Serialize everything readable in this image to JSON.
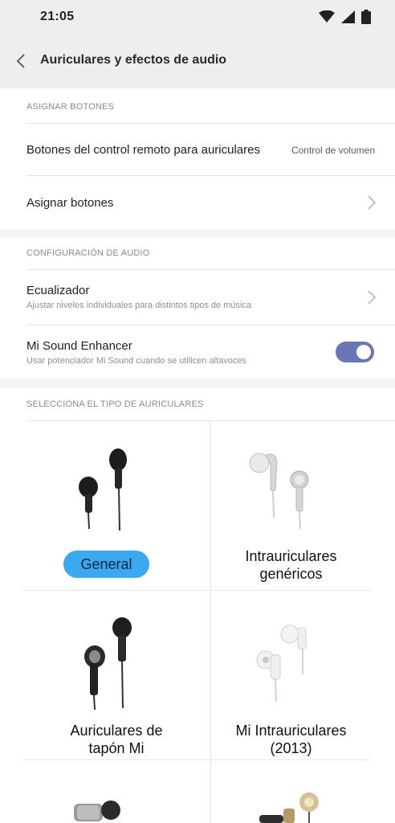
{
  "status_bar": {
    "time": "21:05",
    "icons": [
      "wifi-icon",
      "signal-icon",
      "battery-icon"
    ]
  },
  "header": {
    "title": "Auriculares y efectos de audio",
    "back_icon": "chevron-left-icon"
  },
  "sections": {
    "assign": {
      "header": "ASIGNAR BOTONES",
      "rows": [
        {
          "title": "Botones del control remoto para auriculares",
          "value": "Control de volumen"
        },
        {
          "title": "Asignar botones"
        }
      ]
    },
    "audio": {
      "header": "CONFIGURACIÓN DE AUDIO",
      "rows": [
        {
          "title": "Ecualizador",
          "subtitle": "Ajustar niveles individuales para distintos tipos de música"
        },
        {
          "title": "Mi Sound Enhancer",
          "subtitle": "Usar potenciador Mi Sound cuando se utilicen altavoces",
          "toggle_on": true
        }
      ]
    },
    "headphones": {
      "header": "SELECCIONA EL TIPO DE AURICULARES",
      "selected": "General",
      "items": [
        {
          "line1": "General",
          "line2": ""
        },
        {
          "line1": "Intrauriculares",
          "line2": "genéricos"
        },
        {
          "line1": "Auriculares de",
          "line2": "tapón Mi"
        },
        {
          "line1": "Mi Intrauriculares",
          "line2": "(2013)"
        }
      ]
    }
  },
  "colors": {
    "accent_toggle": "#6b76b6",
    "selected_chip": "#3aa9ef",
    "top_bar": "#eeeeee"
  }
}
